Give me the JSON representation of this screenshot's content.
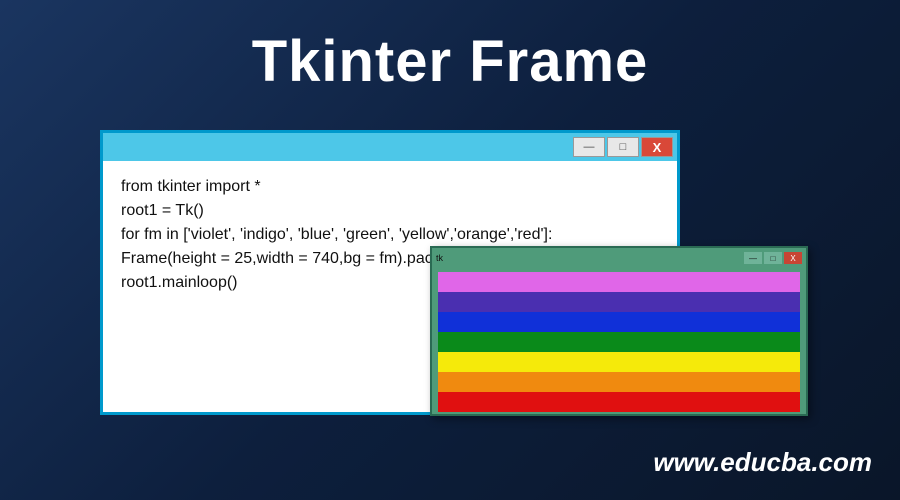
{
  "title": "Tkinter Frame",
  "codeWindow": {
    "buttons": {
      "min": "—",
      "max": "□",
      "close": "X"
    },
    "lines": [
      "from tkinter import *",
      "root1 = Tk()",
      "for fm in ['violet', 'indigo', 'blue', 'green', 'yellow','orange','red']:",
      "Frame(height = 25,width = 740,bg = fm).pack()",
      "root1.mainloop()"
    ]
  },
  "rainbowWindow": {
    "tkLabel": "tk",
    "buttons": {
      "min": "—",
      "max": "□",
      "close": "X"
    },
    "colors": [
      "#e066e8",
      "#4a2fb0",
      "#1030d8",
      "#0a8a1a",
      "#f5ea0a",
      "#f08a0f",
      "#e01010"
    ]
  },
  "watermark": "www.educba.com"
}
